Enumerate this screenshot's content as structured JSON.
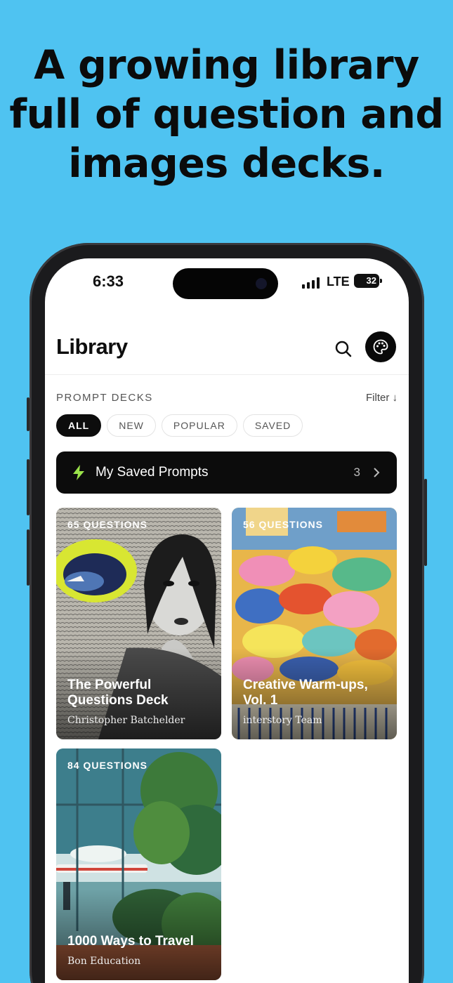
{
  "headline": {
    "line1": "A growing library",
    "line2": "full of question and",
    "line3": "images decks."
  },
  "status_bar": {
    "time": "6:33",
    "network": "LTE",
    "battery": "32"
  },
  "header": {
    "title": "Library",
    "search_icon": "search-icon",
    "palette_icon": "palette-icon"
  },
  "section": {
    "label": "PROMPT DECKS",
    "filter_label": "Filter ↓"
  },
  "chips": [
    {
      "label": "ALL",
      "active": true
    },
    {
      "label": "NEW",
      "active": false
    },
    {
      "label": "POPULAR",
      "active": false
    },
    {
      "label": "SAVED",
      "active": false
    }
  ],
  "saved_prompts": {
    "label": "My Saved Prompts",
    "count": "3",
    "icon": "lightning-icon",
    "accent": "#9be34a"
  },
  "decks": [
    {
      "count": "65 QUESTIONS",
      "title_line1": "The Powerful",
      "title_line2": "Questions Deck",
      "author": "Christopher Batchelder"
    },
    {
      "count": "56 QUESTIONS",
      "title_line1": "Creative Warm-ups,",
      "title_line2": "Vol. 1",
      "author": "interstory Team"
    },
    {
      "count": "84 QUESTIONS",
      "title_line1": "1000 Ways to Travel",
      "title_line2": "",
      "author": "Bon Education"
    }
  ],
  "colors": {
    "background": "#4fc3f1",
    "dark": "#0c0c0c"
  }
}
